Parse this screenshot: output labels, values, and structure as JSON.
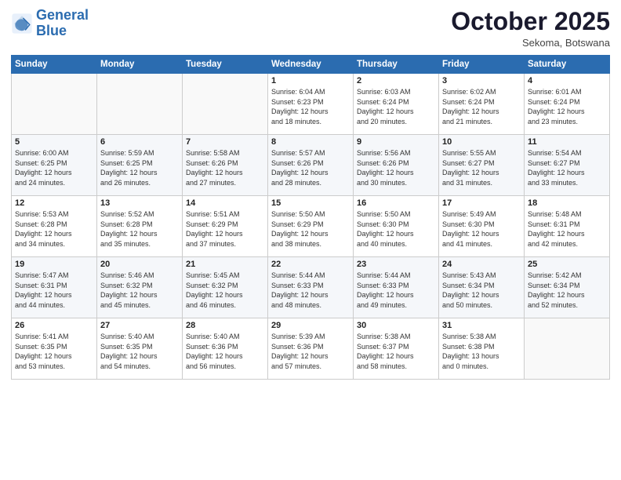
{
  "header": {
    "logo_line1": "General",
    "logo_line2": "Blue",
    "month": "October 2025",
    "location": "Sekoma, Botswana"
  },
  "weekdays": [
    "Sunday",
    "Monday",
    "Tuesday",
    "Wednesday",
    "Thursday",
    "Friday",
    "Saturday"
  ],
  "weeks": [
    [
      {
        "day": "",
        "info": ""
      },
      {
        "day": "",
        "info": ""
      },
      {
        "day": "",
        "info": ""
      },
      {
        "day": "1",
        "info": "Sunrise: 6:04 AM\nSunset: 6:23 PM\nDaylight: 12 hours\nand 18 minutes."
      },
      {
        "day": "2",
        "info": "Sunrise: 6:03 AM\nSunset: 6:24 PM\nDaylight: 12 hours\nand 20 minutes."
      },
      {
        "day": "3",
        "info": "Sunrise: 6:02 AM\nSunset: 6:24 PM\nDaylight: 12 hours\nand 21 minutes."
      },
      {
        "day": "4",
        "info": "Sunrise: 6:01 AM\nSunset: 6:24 PM\nDaylight: 12 hours\nand 23 minutes."
      }
    ],
    [
      {
        "day": "5",
        "info": "Sunrise: 6:00 AM\nSunset: 6:25 PM\nDaylight: 12 hours\nand 24 minutes."
      },
      {
        "day": "6",
        "info": "Sunrise: 5:59 AM\nSunset: 6:25 PM\nDaylight: 12 hours\nand 26 minutes."
      },
      {
        "day": "7",
        "info": "Sunrise: 5:58 AM\nSunset: 6:26 PM\nDaylight: 12 hours\nand 27 minutes."
      },
      {
        "day": "8",
        "info": "Sunrise: 5:57 AM\nSunset: 6:26 PM\nDaylight: 12 hours\nand 28 minutes."
      },
      {
        "day": "9",
        "info": "Sunrise: 5:56 AM\nSunset: 6:26 PM\nDaylight: 12 hours\nand 30 minutes."
      },
      {
        "day": "10",
        "info": "Sunrise: 5:55 AM\nSunset: 6:27 PM\nDaylight: 12 hours\nand 31 minutes."
      },
      {
        "day": "11",
        "info": "Sunrise: 5:54 AM\nSunset: 6:27 PM\nDaylight: 12 hours\nand 33 minutes."
      }
    ],
    [
      {
        "day": "12",
        "info": "Sunrise: 5:53 AM\nSunset: 6:28 PM\nDaylight: 12 hours\nand 34 minutes."
      },
      {
        "day": "13",
        "info": "Sunrise: 5:52 AM\nSunset: 6:28 PM\nDaylight: 12 hours\nand 35 minutes."
      },
      {
        "day": "14",
        "info": "Sunrise: 5:51 AM\nSunset: 6:29 PM\nDaylight: 12 hours\nand 37 minutes."
      },
      {
        "day": "15",
        "info": "Sunrise: 5:50 AM\nSunset: 6:29 PM\nDaylight: 12 hours\nand 38 minutes."
      },
      {
        "day": "16",
        "info": "Sunrise: 5:50 AM\nSunset: 6:30 PM\nDaylight: 12 hours\nand 40 minutes."
      },
      {
        "day": "17",
        "info": "Sunrise: 5:49 AM\nSunset: 6:30 PM\nDaylight: 12 hours\nand 41 minutes."
      },
      {
        "day": "18",
        "info": "Sunrise: 5:48 AM\nSunset: 6:31 PM\nDaylight: 12 hours\nand 42 minutes."
      }
    ],
    [
      {
        "day": "19",
        "info": "Sunrise: 5:47 AM\nSunset: 6:31 PM\nDaylight: 12 hours\nand 44 minutes."
      },
      {
        "day": "20",
        "info": "Sunrise: 5:46 AM\nSunset: 6:32 PM\nDaylight: 12 hours\nand 45 minutes."
      },
      {
        "day": "21",
        "info": "Sunrise: 5:45 AM\nSunset: 6:32 PM\nDaylight: 12 hours\nand 46 minutes."
      },
      {
        "day": "22",
        "info": "Sunrise: 5:44 AM\nSunset: 6:33 PM\nDaylight: 12 hours\nand 48 minutes."
      },
      {
        "day": "23",
        "info": "Sunrise: 5:44 AM\nSunset: 6:33 PM\nDaylight: 12 hours\nand 49 minutes."
      },
      {
        "day": "24",
        "info": "Sunrise: 5:43 AM\nSunset: 6:34 PM\nDaylight: 12 hours\nand 50 minutes."
      },
      {
        "day": "25",
        "info": "Sunrise: 5:42 AM\nSunset: 6:34 PM\nDaylight: 12 hours\nand 52 minutes."
      }
    ],
    [
      {
        "day": "26",
        "info": "Sunrise: 5:41 AM\nSunset: 6:35 PM\nDaylight: 12 hours\nand 53 minutes."
      },
      {
        "day": "27",
        "info": "Sunrise: 5:40 AM\nSunset: 6:35 PM\nDaylight: 12 hours\nand 54 minutes."
      },
      {
        "day": "28",
        "info": "Sunrise: 5:40 AM\nSunset: 6:36 PM\nDaylight: 12 hours\nand 56 minutes."
      },
      {
        "day": "29",
        "info": "Sunrise: 5:39 AM\nSunset: 6:36 PM\nDaylight: 12 hours\nand 57 minutes."
      },
      {
        "day": "30",
        "info": "Sunrise: 5:38 AM\nSunset: 6:37 PM\nDaylight: 12 hours\nand 58 minutes."
      },
      {
        "day": "31",
        "info": "Sunrise: 5:38 AM\nSunset: 6:38 PM\nDaylight: 13 hours\nand 0 minutes."
      },
      {
        "day": "",
        "info": ""
      }
    ]
  ]
}
